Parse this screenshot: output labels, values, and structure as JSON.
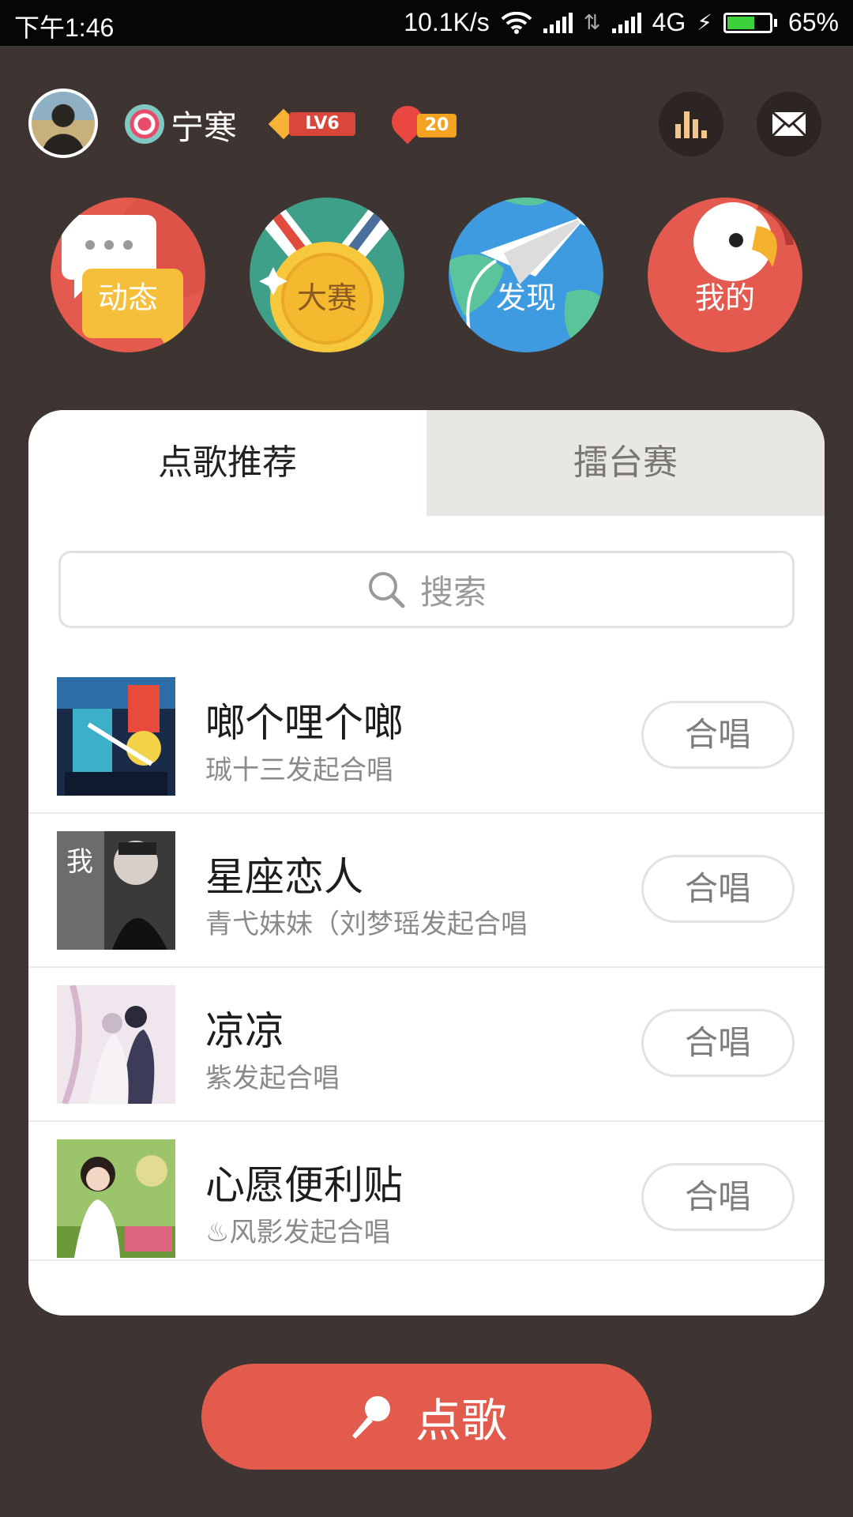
{
  "status_bar": {
    "time": "下午1:46",
    "speed": "10.1K/s",
    "network": "4G",
    "battery": "65%",
    "battery_level": 0.65
  },
  "profile": {
    "username": "宁寒",
    "level": "LV6",
    "flowers": "20"
  },
  "main_nav": [
    {
      "label": "动态",
      "icon": "chat-bubble-icon"
    },
    {
      "label": "大赛",
      "icon": "medal-icon"
    },
    {
      "label": "发现",
      "icon": "paper-plane-globe-icon"
    },
    {
      "label": "我的",
      "icon": "parrot-icon"
    }
  ],
  "tabs": {
    "recommend": "点歌推荐",
    "arena": "擂台赛"
  },
  "search": {
    "placeholder": "搜索"
  },
  "songs": [
    {
      "title": "啷个哩个啷",
      "subtitle": "珹十三发起合唱",
      "action": "合唱"
    },
    {
      "title": "星座恋人",
      "subtitle": "青弋妹妹（刘梦瑶发起合唱",
      "action": "合唱"
    },
    {
      "title": "凉凉",
      "subtitle": "紫发起合唱",
      "action": "合唱"
    },
    {
      "title": "心愿便利贴",
      "subtitle": "♨风影发起合唱",
      "action": "合唱"
    }
  ],
  "sing_button": {
    "label": "点歌"
  },
  "colors": {
    "background": "#3e3432",
    "accent": "#e35b4d",
    "tab_inactive": "#e8e7e3"
  }
}
